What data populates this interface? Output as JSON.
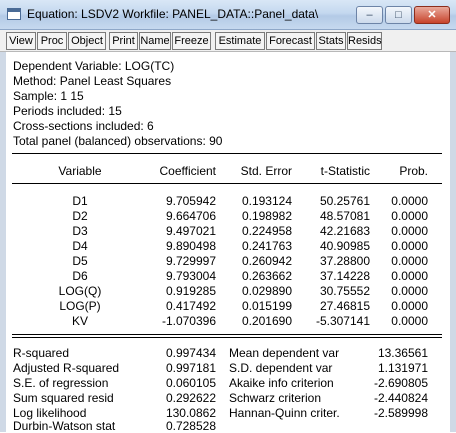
{
  "window": {
    "title": "Equation: LSDV2   Workfile: PANEL_DATA::Panel_data\\",
    "minimize": "–",
    "maximize": "□",
    "close": "✕"
  },
  "toolbar": {
    "view": "View",
    "proc": "Proc",
    "object": "Object",
    "print": "Print",
    "name": "Name",
    "freeze": "Freeze",
    "estimate": "Estimate",
    "forecast": "Forecast",
    "stats": "Stats",
    "resids": "Resids"
  },
  "header": {
    "dependent": "Dependent Variable: LOG(TC)",
    "method": "Method: Panel Least Squares",
    "sample": "Sample: 1 15",
    "periods": "Periods included: 15",
    "cross_sections": "Cross-sections included: 6",
    "observations": "Total panel (balanced) observations: 90"
  },
  "table": {
    "col_variable": "Variable",
    "col_coefficient": "Coefficient",
    "col_stderr": "Std. Error",
    "col_tstat": "t-Statistic",
    "col_prob": "Prob.",
    "rows": [
      {
        "variable": "D1",
        "coefficient": "9.705942",
        "stderr": "0.193124",
        "tstat": "50.25761",
        "prob": "0.0000"
      },
      {
        "variable": "D2",
        "coefficient": "9.664706",
        "stderr": "0.198982",
        "tstat": "48.57081",
        "prob": "0.0000"
      },
      {
        "variable": "D3",
        "coefficient": "9.497021",
        "stderr": "0.224958",
        "tstat": "42.21683",
        "prob": "0.0000"
      },
      {
        "variable": "D4",
        "coefficient": "9.890498",
        "stderr": "0.241763",
        "tstat": "40.90985",
        "prob": "0.0000"
      },
      {
        "variable": "D5",
        "coefficient": "9.729997",
        "stderr": "0.260942",
        "tstat": "37.28800",
        "prob": "0.0000"
      },
      {
        "variable": "D6",
        "coefficient": "9.793004",
        "stderr": "0.263662",
        "tstat": "37.14228",
        "prob": "0.0000"
      },
      {
        "variable": "LOG(Q)",
        "coefficient": "0.919285",
        "stderr": "0.029890",
        "tstat": "30.75552",
        "prob": "0.0000"
      },
      {
        "variable": "LOG(P)",
        "coefficient": "0.417492",
        "stderr": "0.015199",
        "tstat": "27.46815",
        "prob": "0.0000"
      },
      {
        "variable": "KV",
        "coefficient": "-1.070396",
        "stderr": "0.201690",
        "tstat": "-5.307141",
        "prob": "0.0000"
      }
    ]
  },
  "stats": {
    "rows": [
      {
        "left_label": "R-squared",
        "left_value": "0.997434",
        "right_label": "Mean dependent var",
        "right_value": "13.36561"
      },
      {
        "left_label": "Adjusted R-squared",
        "left_value": "0.997181",
        "right_label": "S.D. dependent var",
        "right_value": "1.131971"
      },
      {
        "left_label": "S.E. of regression",
        "left_value": "0.060105",
        "right_label": "Akaike info criterion",
        "right_value": "-2.690805"
      },
      {
        "left_label": "Sum squared resid",
        "left_value": "0.292622",
        "right_label": "Schwarz criterion",
        "right_value": "-2.440824"
      },
      {
        "left_label": "Log likelihood",
        "left_value": "130.0862",
        "right_label": "Hannan-Quinn criter.",
        "right_value": "-2.589998"
      },
      {
        "left_label": "Durbin-Watson stat",
        "left_value": "0.728528",
        "right_label": "",
        "right_value": ""
      }
    ]
  }
}
